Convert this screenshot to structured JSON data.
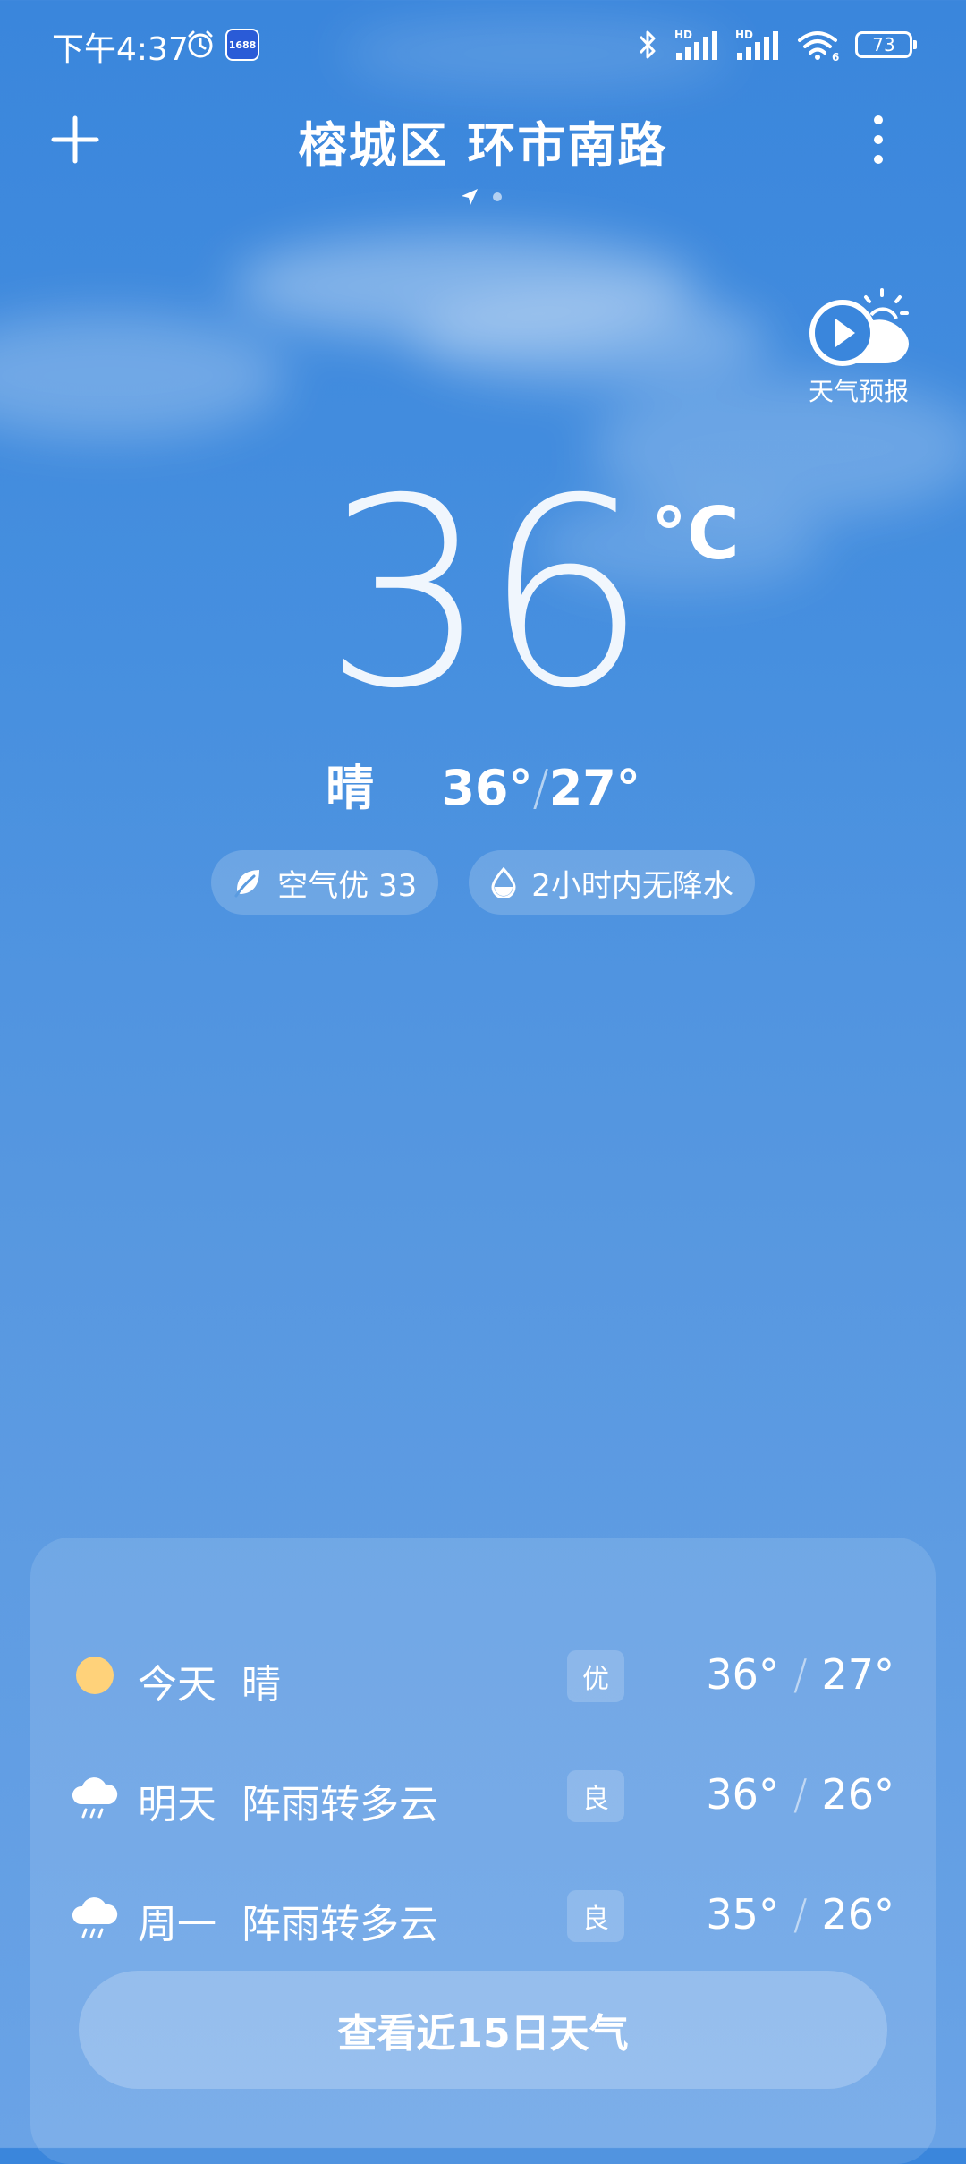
{
  "status_bar": {
    "time": "下午4:37",
    "app_badge": "1688",
    "battery": "73",
    "signal_1_label": "HD",
    "signal_2_label": "HD",
    "wifi_label": "6"
  },
  "header": {
    "location": "榕城区 环市南路",
    "forecast_video_label": "天气预报"
  },
  "current": {
    "temperature": "36",
    "unit": "°C",
    "condition": "晴",
    "high": "36°",
    "low": "27°",
    "separator": "/",
    "air_quality": "空气优 33",
    "precipitation": "2小时内无降水"
  },
  "forecast": [
    {
      "day": "今天",
      "condition": "晴",
      "aqi": "优",
      "high": "36°",
      "low": "27°",
      "icon": "sun-icon"
    },
    {
      "day": "明天",
      "condition": "阵雨转多云",
      "aqi": "良",
      "high": "36°",
      "low": "26°",
      "icon": "rain-cloud-icon"
    },
    {
      "day": "周一",
      "condition": "阵雨转多云",
      "aqi": "良",
      "high": "35°",
      "low": "26°",
      "icon": "rain-cloud-icon"
    }
  ],
  "forecast_separator": "/",
  "fifteen_day_button": "查看近15日天气",
  "colors": {
    "sky_top": "#3a86dc",
    "sky_bottom": "#6aa3e6",
    "sun": "#ffd27a"
  }
}
